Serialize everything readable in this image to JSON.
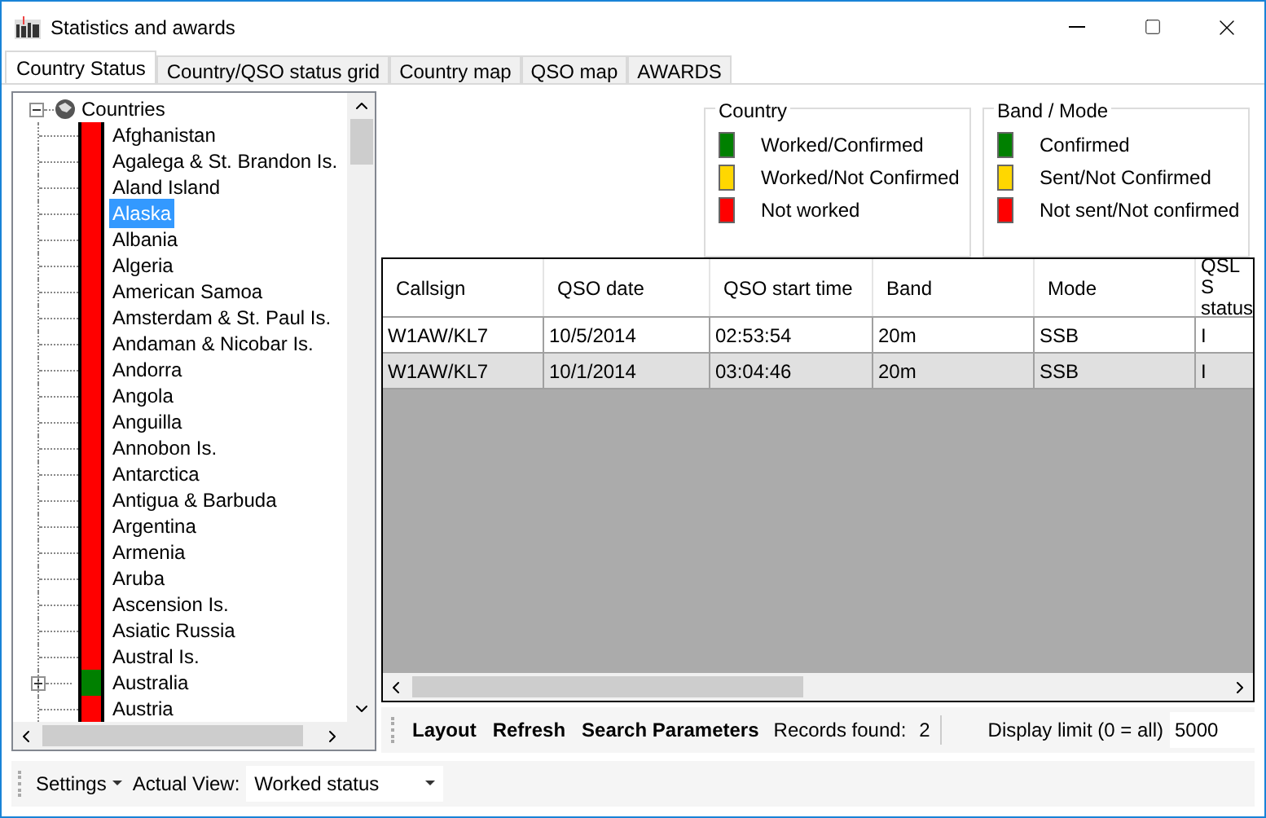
{
  "window": {
    "title": "Statistics and awards"
  },
  "tabs": [
    {
      "label": "Country Status",
      "selected": true
    },
    {
      "label": "Country/QSO status grid",
      "selected": false
    },
    {
      "label": "Country map",
      "selected": false
    },
    {
      "label": "QSO map",
      "selected": false
    },
    {
      "label": "AWARDS",
      "selected": false
    }
  ],
  "tree": {
    "label": "Countries",
    "expanded": true,
    "children": [
      {
        "label": "Afghanistan",
        "color": "#ff0000",
        "selected": false,
        "collapsed": false
      },
      {
        "label": "Agalega & St. Brandon Is.",
        "color": "#ff0000",
        "selected": false,
        "collapsed": false
      },
      {
        "label": "Aland Island",
        "color": "#ff0000",
        "selected": false,
        "collapsed": false
      },
      {
        "label": "Alaska",
        "color": "#ff0000",
        "selected": true,
        "collapsed": false
      },
      {
        "label": "Albania",
        "color": "#ff0000",
        "selected": false,
        "collapsed": false
      },
      {
        "label": "Algeria",
        "color": "#ff0000",
        "selected": false,
        "collapsed": false
      },
      {
        "label": "American Samoa",
        "color": "#ff0000",
        "selected": false,
        "collapsed": false
      },
      {
        "label": "Amsterdam & St. Paul Is.",
        "color": "#ff0000",
        "selected": false,
        "collapsed": false
      },
      {
        "label": "Andaman & Nicobar Is.",
        "color": "#ff0000",
        "selected": false,
        "collapsed": false
      },
      {
        "label": "Andorra",
        "color": "#ff0000",
        "selected": false,
        "collapsed": false
      },
      {
        "label": "Angola",
        "color": "#ff0000",
        "selected": false,
        "collapsed": false
      },
      {
        "label": "Anguilla",
        "color": "#ff0000",
        "selected": false,
        "collapsed": false
      },
      {
        "label": "Annobon Is.",
        "color": "#ff0000",
        "selected": false,
        "collapsed": false
      },
      {
        "label": "Antarctica",
        "color": "#ff0000",
        "selected": false,
        "collapsed": false
      },
      {
        "label": "Antigua & Barbuda",
        "color": "#ff0000",
        "selected": false,
        "collapsed": false
      },
      {
        "label": "Argentina",
        "color": "#ff0000",
        "selected": false,
        "collapsed": false
      },
      {
        "label": "Armenia",
        "color": "#ff0000",
        "selected": false,
        "collapsed": false
      },
      {
        "label": "Aruba",
        "color": "#ff0000",
        "selected": false,
        "collapsed": false
      },
      {
        "label": "Ascension Is.",
        "color": "#ff0000",
        "selected": false,
        "collapsed": false
      },
      {
        "label": "Asiatic Russia",
        "color": "#ff0000",
        "selected": false,
        "collapsed": false
      },
      {
        "label": "Austral Is.",
        "color": "#ff0000",
        "selected": false,
        "collapsed": false
      },
      {
        "label": "Australia",
        "color": "#008000",
        "selected": false,
        "collapsed": true
      },
      {
        "label": "Austria",
        "color": "#ff0000",
        "selected": false,
        "collapsed": false
      }
    ]
  },
  "legends": [
    {
      "title": "Country",
      "items": [
        {
          "label": "Worked/Confirmed",
          "color": "#008000"
        },
        {
          "label": "Worked/Not Confirmed",
          "color": "#ffd700"
        },
        {
          "label": "Not worked",
          "color": "#ff0000"
        }
      ]
    },
    {
      "title": "Band / Mode",
      "items": [
        {
          "label": "Confirmed",
          "color": "#008000"
        },
        {
          "label": "Sent/Not Confirmed",
          "color": "#ffd700"
        },
        {
          "label": "Not sent/Not confirmed",
          "color": "#ff0000"
        }
      ]
    }
  ],
  "table": {
    "columns": [
      "Callsign",
      "QSO date",
      "QSO start time",
      "Band",
      "Mode",
      "QSL S status"
    ],
    "rows": [
      {
        "cells": [
          "W1AW/KL7",
          "10/5/2014",
          "02:53:54",
          "20m",
          "SSB",
          "I"
        ],
        "selected": false
      },
      {
        "cells": [
          "W1AW/KL7",
          "10/1/2014",
          "03:04:46",
          "20m",
          "SSB",
          "I"
        ],
        "selected": true
      }
    ]
  },
  "grid_toolbar": {
    "buttons": [
      "Layout",
      "Refresh",
      "Search Parameters"
    ],
    "records_label": "Records found:",
    "records": "2",
    "limit_label": "Display limit (0 = all)",
    "limit_value": "5000"
  },
  "bottom_bar": {
    "settings": "Settings",
    "view_label": "Actual View:",
    "view_value": "Worked status"
  }
}
